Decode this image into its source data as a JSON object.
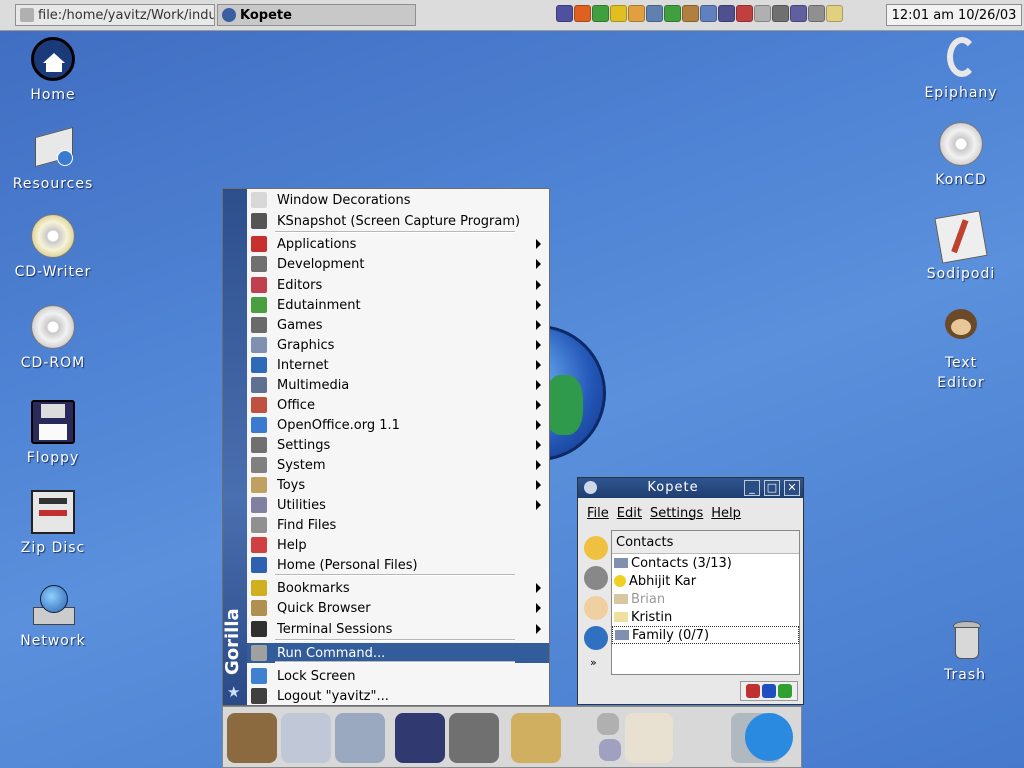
{
  "top_panel": {
    "tasks": [
      {
        "label": "file:/home/yavitz/Work/indus",
        "active": false
      },
      {
        "label": "Kopete",
        "active": true
      }
    ],
    "tray_icons": [
      "mozilla-icon",
      "fire-icon",
      "refresh-icon",
      "smiley-icon",
      "mouth-icon",
      "screen-icon",
      "vcheck-icon",
      "package-icon",
      "pencil-icon",
      "printer-icon",
      "book-icon",
      "cube-icon",
      "speaker-icon",
      "grid-icon",
      "eye-icon",
      "note-icon"
    ],
    "clock": "12:01 am 10/26/03"
  },
  "desktop_left": [
    {
      "label": "Home",
      "icon": "home-icon"
    },
    {
      "label": "Resources",
      "icon": "drive-icon"
    },
    {
      "label": "CD-Writer",
      "icon": "cd-writer-icon"
    },
    {
      "label": "CD-ROM",
      "icon": "cdrom-icon"
    },
    {
      "label": "Floppy",
      "icon": "floppy-icon"
    },
    {
      "label": "Zip Disc",
      "icon": "zip-disc-icon"
    },
    {
      "label": "Network",
      "icon": "network-icon"
    }
  ],
  "desktop_right": [
    {
      "label": "Epiphany",
      "icon": "epiphany-icon"
    },
    {
      "label": "KonCD",
      "icon": "koncd-icon"
    },
    {
      "label": "Sodipodi",
      "icon": "sodipodi-icon"
    },
    {
      "label": "Text",
      "label2": "Editor",
      "icon": "text-editor-icon"
    },
    {
      "label": "Trash",
      "icon": "trash-icon"
    }
  ],
  "start_menu": {
    "sidebar_label": "Gorilla",
    "items": [
      {
        "label": "Window Decorations",
        "submenu": false,
        "icon": "window-decorations-icon",
        "color": "#d8d8d8"
      },
      {
        "label": "KSnapshot (Screen Capture Program)",
        "submenu": false,
        "icon": "camera-icon",
        "color": "#555555"
      },
      {
        "label": "Applications",
        "submenu": true,
        "icon": "applications-icon",
        "color": "#c83030"
      },
      {
        "label": "Development",
        "submenu": true,
        "icon": "development-icon",
        "color": "#707070"
      },
      {
        "label": "Editors",
        "submenu": true,
        "icon": "editors-icon",
        "color": "#c04050"
      },
      {
        "label": "Edutainment",
        "submenu": true,
        "icon": "edutainment-icon",
        "color": "#4aa040"
      },
      {
        "label": "Games",
        "submenu": true,
        "icon": "games-icon",
        "color": "#6a6a6a"
      },
      {
        "label": "Graphics",
        "submenu": true,
        "icon": "graphics-icon",
        "color": "#8090b0"
      },
      {
        "label": "Internet",
        "submenu": true,
        "icon": "internet-icon",
        "color": "#2f6ab8"
      },
      {
        "label": "Multimedia",
        "submenu": true,
        "icon": "multimedia-icon",
        "color": "#607090"
      },
      {
        "label": "Office",
        "submenu": true,
        "icon": "office-icon",
        "color": "#c05040"
      },
      {
        "label": "OpenOffice.org 1.1",
        "submenu": true,
        "icon": "openoffice-icon",
        "color": "#3a7ad0"
      },
      {
        "label": "Settings",
        "submenu": true,
        "icon": "settings-icon",
        "color": "#707070"
      },
      {
        "label": "System",
        "submenu": true,
        "icon": "system-icon",
        "color": "#808080"
      },
      {
        "label": "Toys",
        "submenu": true,
        "icon": "toys-icon",
        "color": "#c0a060"
      },
      {
        "label": "Utilities",
        "submenu": true,
        "icon": "utilities-icon",
        "color": "#8080a0"
      },
      {
        "label": "Find Files",
        "submenu": false,
        "icon": "find-files-icon",
        "color": "#909090"
      },
      {
        "label": "Help",
        "submenu": false,
        "icon": "help-icon",
        "color": "#d04040"
      },
      {
        "label": "Home (Personal Files)",
        "submenu": false,
        "icon": "home-folder-icon",
        "color": "#3060b0"
      },
      {
        "label": "Bookmarks",
        "submenu": true,
        "icon": "bookmarks-icon",
        "color": "#d0b020"
      },
      {
        "label": "Quick Browser",
        "submenu": true,
        "icon": "quick-browser-icon",
        "color": "#b09050"
      },
      {
        "label": "Terminal Sessions",
        "submenu": true,
        "icon": "terminal-icon",
        "color": "#303030"
      },
      {
        "label": "Run Command...",
        "submenu": false,
        "icon": "run-command-icon",
        "color": "#a0a0a0",
        "selected": true
      },
      {
        "label": "Lock Screen",
        "submenu": false,
        "icon": "lock-screen-icon",
        "color": "#4080d0"
      },
      {
        "label": "Logout \"yavitz\"...",
        "submenu": false,
        "icon": "logout-icon",
        "color": "#404040"
      }
    ]
  },
  "kopete": {
    "title": "Kopete",
    "menu": [
      "File",
      "Edit",
      "Settings",
      "Help"
    ],
    "header": "Contacts",
    "rows": [
      {
        "name": "Contacts  (3/13)",
        "icon": "folder-icon",
        "dim": false
      },
      {
        "name": "Abhijit Kar",
        "icon": "smiley-online-icon",
        "dim": false
      },
      {
        "name": "Brian",
        "icon": "offline-icon",
        "dim": true
      },
      {
        "name": "Kristin",
        "icon": "away-icon",
        "dim": false
      },
      {
        "name": "Family  (0/7)",
        "icon": "folder-icon",
        "dim": false
      }
    ]
  },
  "bottom_panel": {
    "buttons": [
      "gorilla-menu-icon",
      "magnifier-icon",
      "mail-icon",
      "terminal-launch-icon",
      "tools-icon",
      "paint-icon",
      "clipboard-icon",
      "volume-icon",
      "desktop-icon",
      "window-list-icon",
      "gnome-foot-icon",
      "konqueror-icon"
    ]
  }
}
